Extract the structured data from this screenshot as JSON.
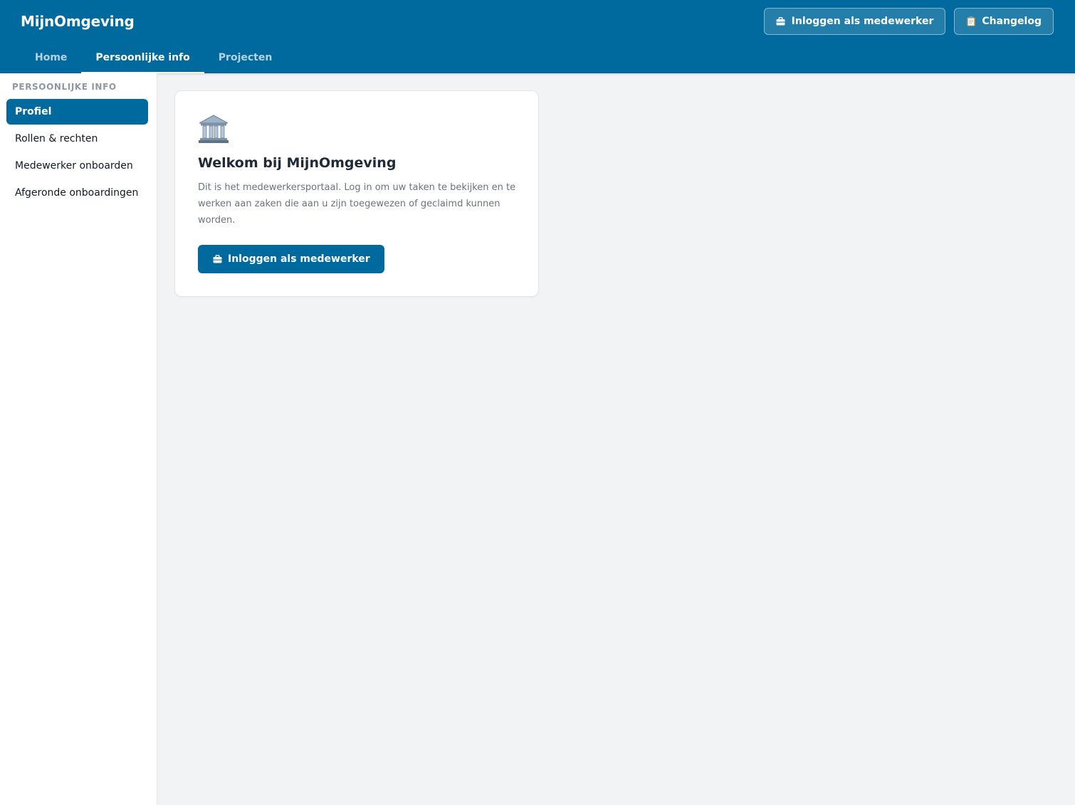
{
  "header": {
    "brand": "MijnOmgeving",
    "actions": [
      {
        "label": "Inloggen als medewerker",
        "icon": "briefcase-icon"
      },
      {
        "label": "Changelog",
        "icon": "clipboard-icon"
      }
    ],
    "tabs": [
      {
        "label": "Home",
        "active": false
      },
      {
        "label": "Persoonlijke info",
        "active": true
      },
      {
        "label": "Projecten",
        "active": false
      }
    ]
  },
  "sidebar": {
    "heading": "PERSOONLIJKE INFO",
    "items": [
      {
        "label": "Profiel",
        "active": true
      },
      {
        "label": "Rollen & rechten",
        "active": false
      },
      {
        "label": "Medewerker onboarden",
        "active": false
      },
      {
        "label": "Afgeronde onboardingen",
        "active": false
      }
    ]
  },
  "welcome_card": {
    "icon": "classical-building-icon",
    "title": "Welkom bij MijnOmgeving",
    "text": "Dit is het medewerkersportaal. Log in om uw taken te bekijken en te werken aan zaken die aan u zijn toegewezen of geclaimd kunnen worden.",
    "button_label": "Inloggen als medewerker",
    "button_icon": "briefcase-icon"
  },
  "colors": {
    "primary": "#00699d",
    "background": "#f2f3f5",
    "card": "#ffffff",
    "muted_text": "#6b7280"
  }
}
